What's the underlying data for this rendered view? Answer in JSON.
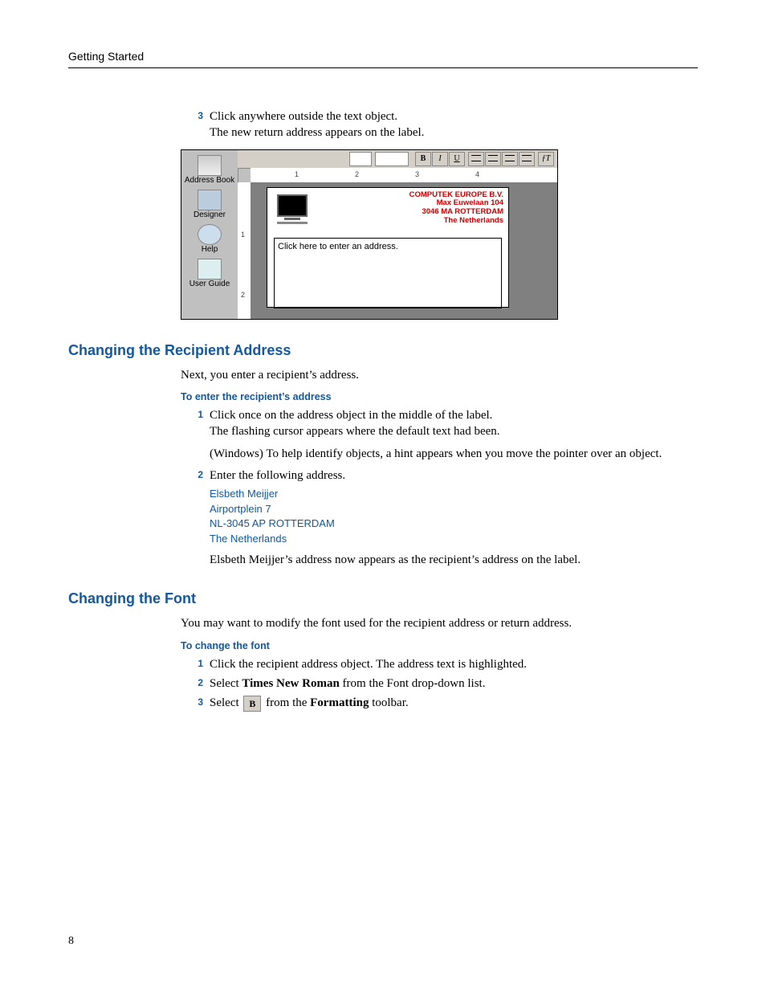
{
  "running_head": "Getting Started",
  "page_number": "8",
  "intro_step": {
    "num": "3",
    "line1": "Click anywhere outside the text object.",
    "line2": "The new return address appears on the label."
  },
  "screenshot": {
    "sidebar": {
      "address_book": "Address Book",
      "designer": "Designer",
      "help": "Help",
      "user_guide": "User Guide"
    },
    "toolbar": {
      "b": "B",
      "i": "I",
      "u": "U",
      "ft": "ƒT"
    },
    "ruler": {
      "r1": "1",
      "r2": "2",
      "r3": "3",
      "r4": "4",
      "v1": "1",
      "v2": "2"
    },
    "return_addr": {
      "l1": "COMPUTEK EUROPE B.V.",
      "l2": "Max Euwelaan 104",
      "l3": "3046 MA  ROTTERDAM",
      "l4": "The Netherlands"
    },
    "placeholder": "Click here to enter an address."
  },
  "section1": {
    "title": "Changing the Recipient Address",
    "intro": "Next, you enter a recipient’s address.",
    "subhead": "To enter the recipient’s address",
    "step1": {
      "num": "1",
      "l1": "Click once on the address object in the middle of the label.",
      "l2": "The flashing cursor appears where the default text had been.",
      "l3": "(Windows) To help identify objects, a hint appears when you move the pointer over an object."
    },
    "step2": {
      "num": "2",
      "l1": "Enter the following address.",
      "addr1": "Elsbeth Meijjer",
      "addr2": "Airportplein 7",
      "addr3": "NL-3045 AP ROTTERDAM",
      "addr4": "The Netherlands",
      "after": "Elsbeth Meijjer’s address now appears as the recipient’s address on the label."
    }
  },
  "section2": {
    "title": "Changing the Font",
    "intro": "You may want to modify the font used for the recipient address or return address.",
    "subhead": "To change the font",
    "step1": {
      "num": "1",
      "text": "Click the recipient address object. The address text is highlighted."
    },
    "step2": {
      "num": "2",
      "pre": "Select ",
      "bold": "Times New Roman",
      "post": " from the Font drop-down list."
    },
    "step3": {
      "num": "3",
      "pre": "Select ",
      "btn": "B",
      "mid": " from the ",
      "bold": "Formatting",
      "post": " toolbar."
    }
  }
}
